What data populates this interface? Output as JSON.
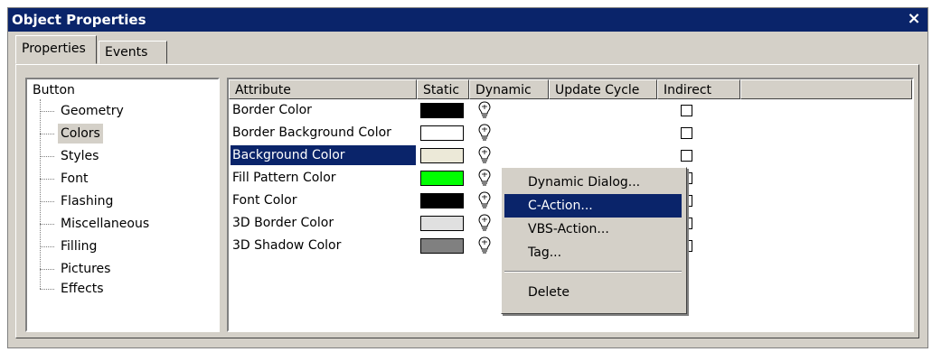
{
  "window": {
    "title": "Object Properties",
    "close_glyph": "×"
  },
  "tabs": [
    {
      "label": "Properties"
    },
    {
      "label": "Events"
    }
  ],
  "tree": {
    "root": "Button",
    "items": [
      "Geometry",
      "Colors",
      "Styles",
      "Font",
      "Flashing",
      "Miscellaneous",
      "Filling",
      "Pictures",
      "Effects"
    ],
    "selected": "Colors"
  },
  "grid": {
    "columns": [
      "Attribute",
      "Static",
      "Dynamic",
      "Update Cycle",
      "Indirect"
    ],
    "rows": [
      {
        "attribute": "Border Color",
        "static_color": "#000000"
      },
      {
        "attribute": "Border Background Color",
        "static_color": "#ffffff"
      },
      {
        "attribute": "Background Color",
        "static_color": "#ece9d8"
      },
      {
        "attribute": "Fill Pattern Color",
        "static_color": "#00ff00"
      },
      {
        "attribute": "Font Color",
        "static_color": "#000000"
      },
      {
        "attribute": "3D Border Color",
        "static_color": "#e0e0e0"
      },
      {
        "attribute": "3D Shadow Color",
        "static_color": "#808080"
      }
    ],
    "selected_row": "Background Color"
  },
  "context_menu": {
    "items": [
      "Dynamic Dialog...",
      "C-Action...",
      "VBS-Action...",
      "Tag...",
      "Delete"
    ],
    "highlighted": "C-Action..."
  },
  "colors": {
    "title_bar": "#0a246a",
    "face": "#d4d0c8",
    "selection": "#0a246a"
  }
}
